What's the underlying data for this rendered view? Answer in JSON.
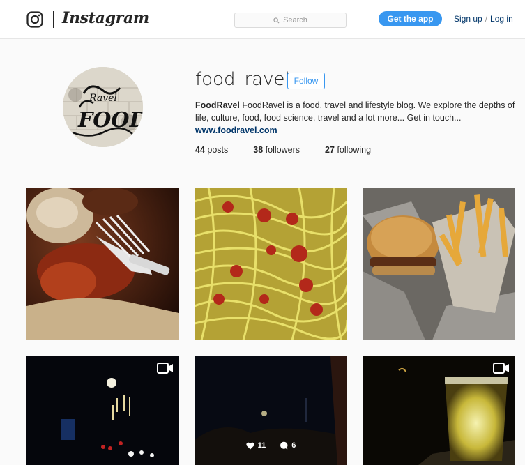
{
  "nav": {
    "brand": "Instagram",
    "search_placeholder": "Search",
    "get_app": "Get the app",
    "sign_up": "Sign up",
    "separator": "/",
    "log_in": "Log in"
  },
  "profile": {
    "username": "food_ravel",
    "follow_label": "Follow",
    "full_name": "FoodRavel",
    "bio": "FoodRavel is a food, travel and lifestyle blog. We explore the depths of life, culture, food, food science, travel and a lot more... Get in touch...",
    "website": "www.foodravel.com",
    "avatar_logo_text": "Ravel FOOD",
    "stats": {
      "posts_count": "44",
      "posts_label": "posts",
      "followers_count": "38",
      "followers_label": "followers",
      "following_count": "27",
      "following_label": "following"
    }
  },
  "posts": [
    {
      "subject": "dumpling-with-fork",
      "is_video": false
    },
    {
      "subject": "noodles",
      "is_video": false
    },
    {
      "subject": "burger-and-fries",
      "is_video": false
    },
    {
      "subject": "night-street-lights",
      "is_video": true
    },
    {
      "subject": "night-sky",
      "is_video": false,
      "likes": "11",
      "comments": "6"
    },
    {
      "subject": "beer-glass",
      "is_video": true
    }
  ]
}
